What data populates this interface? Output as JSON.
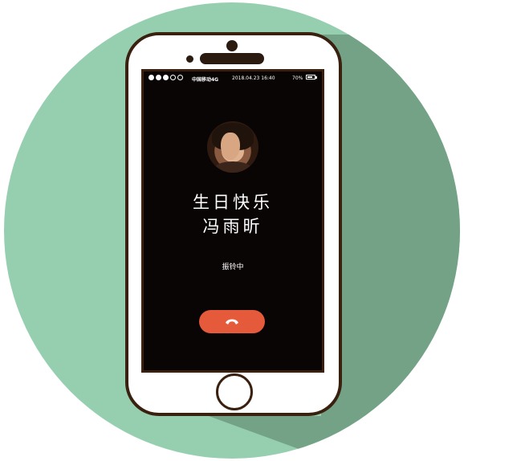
{
  "colors": {
    "circle": "#96cfb0",
    "shadow": "#74a287",
    "phone_outline": "#3a200f",
    "screen": "#0a0505",
    "hangup": "#e55a3a"
  },
  "status_bar": {
    "signal_bars_filled": 3,
    "signal_bars_total": 5,
    "carrier": "中国移动4G",
    "datetime": "2018.04.23 16:40",
    "battery_percent": "70%",
    "battery_level": 0.7
  },
  "call": {
    "caller_line1": "生日快乐",
    "caller_line2": "冯雨昕",
    "status": "振铃中",
    "avatar_icon": "contact-photo"
  },
  "controls": {
    "hangup_icon": "phone-hangup-icon",
    "home_icon": "home-button"
  }
}
